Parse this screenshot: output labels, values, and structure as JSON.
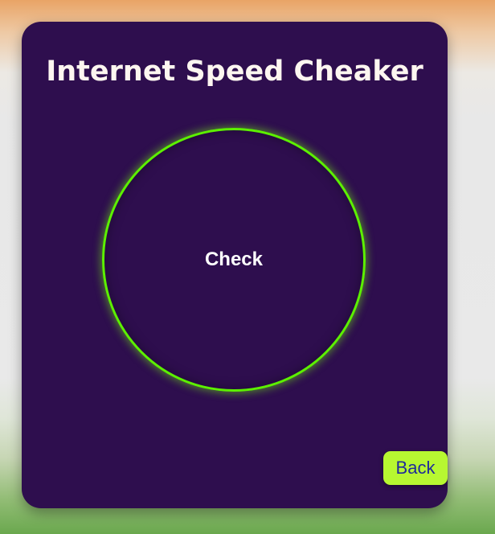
{
  "app": {
    "title": "Internet Speed Cheaker"
  },
  "gauge": {
    "button_label": "Check"
  },
  "footer": {
    "back_label": "Back"
  },
  "colors": {
    "card_background": "#2e0e4e",
    "ring": "#5cf000",
    "back_button": "#b7f731",
    "back_text": "#1f2a9a"
  }
}
